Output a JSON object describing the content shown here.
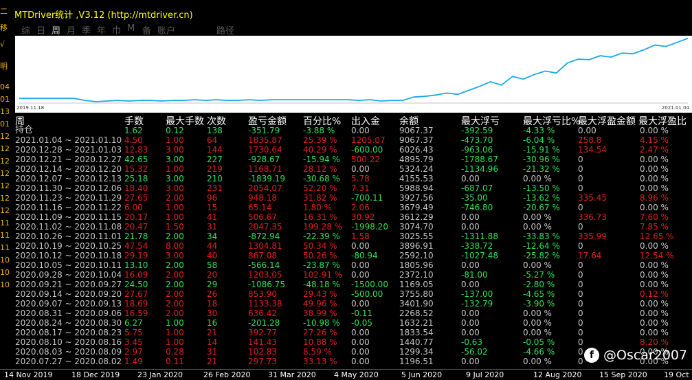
{
  "window": {
    "title": "MTDriver统计 ,V3.12 (http://mtdriver.cn)"
  },
  "left_strip": [
    "二",
    "移",
    "√",
    "明",
    "04",
    "01",
    "13",
    "01",
    "12",
    "12",
    "12",
    "12",
    "12",
    "12",
    "12",
    "11",
    "11",
    "11",
    "10",
    "10",
    "10"
  ],
  "toolbar": [
    "综",
    "日",
    "周",
    "月",
    "季",
    "年",
    "巾",
    "M",
    "备",
    "账户",
    "路径"
  ],
  "toolbar_active": "周",
  "chart": {
    "start_label": "2019.11.18",
    "end_label": "2021.01.04",
    "line_color": "#1aa7e6"
  },
  "chart_data": {
    "type": "line",
    "series": [
      {
        "values": [
          0,
          0,
          0,
          0,
          0,
          0,
          -0.3,
          -0.5,
          -0.4,
          -0.3,
          -0.4,
          -0.3,
          -0.3,
          -0.4,
          -0.3,
          -0.3,
          -0.2,
          -0.3,
          -0.2,
          -0.3,
          -0.3,
          -0.2,
          -0.3,
          -0.2,
          -0.2,
          -0.2,
          -0.2,
          -0.2,
          -0.2,
          -0.2,
          -0.2,
          -0.3,
          -0.2,
          -0.4,
          -0.3,
          -0.3,
          0.2,
          0.3,
          0.5,
          0.8,
          0.6,
          1.2,
          1.8,
          2.5,
          2.0,
          3.3,
          2.9,
          3.6,
          4.1,
          3.8,
          5.3,
          5.9,
          5.8,
          6.4,
          6.2,
          6.8,
          6.7,
          7.3,
          8.0,
          7.8,
          8.4,
          9.0
        ]
      }
    ]
  },
  "headers": [
    "周",
    "手数",
    "最大手数",
    "次数",
    "盈亏金额",
    "百分比%",
    "出入金",
    "余额",
    "最大浮亏",
    "最大浮亏比%",
    "最大浮盈金额",
    "最大浮盈比"
  ],
  "rows": [
    {
      "period": "持仓",
      "lots": "1.62",
      "max_lots": "0.12",
      "count": "138",
      "pnl": "-351.79",
      "pct": "-3.88 %",
      "io": "0.00",
      "bal": "9067.37",
      "mdd": "-392.59",
      "mddp": "-4.33 %",
      "mfe": "0.00",
      "mfep": "0.00 %",
      "col": "g"
    },
    {
      "period": "2021.01.04 ~ 2021.01.10",
      "lots": "4.50",
      "max_lots": "1.00",
      "count": "64",
      "pnl": "1835.87",
      "pct": "25.39 %",
      "io": "1205.07",
      "bal": "9067.37",
      "mdd": "-473.70",
      "mddp": "-6.04 %",
      "mfe": "258.8",
      "mfep": "4.15 %",
      "col": "r"
    },
    {
      "period": "2020.12.28 ~ 2021.01.03",
      "lots": "12.83",
      "max_lots": "3.00",
      "count": "144",
      "pnl": "1730.64",
      "pct": "40.29 %",
      "io": "-600.00",
      "bal": "6026.43",
      "mdd": "-963.06",
      "mddp": "-15.91 %",
      "mfe": "134.54",
      "mfep": "2.47 %",
      "col": "r"
    },
    {
      "period": "2020.12.21 ~ 2020.12.27",
      "lots": "42.65",
      "max_lots": "3.00",
      "count": "227",
      "pnl": "-928.67",
      "pct": "-15.94 %",
      "io": "500.22",
      "bal": "4895.79",
      "mdd": "-1788.67",
      "mddp": "-30.96 %",
      "mfe": "0",
      "mfep": "0.00 %",
      "col": "g"
    },
    {
      "period": "2020.12.14 ~ 2020.12.20",
      "lots": "15.32",
      "max_lots": "1.00",
      "count": "219",
      "pnl": "1168.71",
      "pct": "28.12 %",
      "io": "0.00",
      "bal": "5324.24",
      "mdd": "-1134.96",
      "mddp": "-21.32 %",
      "mfe": "0",
      "mfep": "0.00 %",
      "col": "r"
    },
    {
      "period": "2020.12.07 ~ 2020.12.13",
      "lots": "25.18",
      "max_lots": "3.00",
      "count": "210",
      "pnl": "-1839.19",
      "pct": "-30.68 %",
      "io": "5.78",
      "bal": "4155.53",
      "mdd": "0.00",
      "mddp": "0.00 %",
      "mfe": "0",
      "mfep": "0.00 %",
      "col": "g"
    },
    {
      "period": "2020.11.30 ~ 2020.12.06",
      "lots": "18.40",
      "max_lots": "3.00",
      "count": "231",
      "pnl": "2054.07",
      "pct": "52.20 %",
      "io": "7.31",
      "bal": "5988.94",
      "mdd": "-687.07",
      "mddp": "-13.50 %",
      "mfe": "0",
      "mfep": "0.00 %",
      "col": "r"
    },
    {
      "period": "2020.11.23 ~ 2020.11.29",
      "lots": "27.65",
      "max_lots": "2.00",
      "count": "96",
      "pnl": "948.18",
      "pct": "31.82 %",
      "io": "-700.11",
      "bal": "3927.56",
      "mdd": "-35.00",
      "mddp": "-13.62 %",
      "mfe": "335.45",
      "mfep": "8.96 %",
      "col": "r"
    },
    {
      "period": "2020.11.16 ~ 2020.11.22",
      "lots": "6.00",
      "max_lots": "1.00",
      "count": "15",
      "pnl": "65.14",
      "pct": "1.80 %",
      "io": "2.06",
      "bal": "3679.49",
      "mdd": "-746.80",
      "mddp": "-20.67 %",
      "mfe": "0",
      "mfep": "0.00 %",
      "col": "r"
    },
    {
      "period": "2020.11.09 ~ 2020.11.15",
      "lots": "20.17",
      "max_lots": "1.00",
      "count": "41",
      "pnl": "506.67",
      "pct": "16.31 %",
      "io": "30.92",
      "bal": "3612.29",
      "mdd": "0.00",
      "mddp": "0.00 %",
      "mfe": "336.73",
      "mfep": "7.60 %",
      "col": "r"
    },
    {
      "period": "2020.11.02 ~ 2020.11.08",
      "lots": "20.47",
      "max_lots": "1.50",
      "count": "31",
      "pnl": "2047.35",
      "pct": "199.28 %",
      "io": "-1998.20",
      "bal": "3074.70",
      "mdd": "0.00",
      "mddp": "0.00 %",
      "mfe": "0",
      "mfep": "7.85 %",
      "col": "r"
    },
    {
      "period": "2020.10.26 ~ 2020.11.01",
      "lots": "21.78",
      "max_lots": "2.00",
      "count": "34",
      "pnl": "-872.94",
      "pct": "-22.39 %",
      "io": "1.58",
      "bal": "3025.55",
      "mdd": "-1311.88",
      "mddp": "-33.83 %",
      "mfe": "335.99",
      "mfep": "12.65 %",
      "col": "g"
    },
    {
      "period": "2020.10.19 ~ 2020.10.25",
      "lots": "47.54",
      "max_lots": "8.00",
      "count": "44",
      "pnl": "1304.81",
      "pct": "50.34 %",
      "io": "0.00",
      "bal": "3896.91",
      "mdd": "-338.72",
      "mddp": "-12.64 %",
      "mfe": "0",
      "mfep": "0.00 %",
      "col": "r"
    },
    {
      "period": "2020.10.12 ~ 2020.10.18",
      "lots": "29.19",
      "max_lots": "3.00",
      "count": "40",
      "pnl": "867.08",
      "pct": "50.26 %",
      "io": "-80.94",
      "bal": "2592.10",
      "mdd": "-1027.48",
      "mddp": "-25.82 %",
      "mfe": "17.64",
      "mfep": "12.54 %",
      "col": "r"
    },
    {
      "period": "2020.10.05 ~ 2020.10.11",
      "lots": "13.10",
      "max_lots": "2.00",
      "count": "58",
      "pnl": "-566.14",
      "pct": "-23.87 %",
      "io": "0.00",
      "bal": "1805.96",
      "mdd": "0.00",
      "mddp": "0.00 %",
      "mfe": "0",
      "mfep": "0.00 %",
      "col": "g"
    },
    {
      "period": "2020.09.28 ~ 2020.10.04",
      "lots": "16.09",
      "max_lots": "2.00",
      "count": "20",
      "pnl": "1203.05",
      "pct": "102.91 %",
      "io": "0.00",
      "bal": "2372.10",
      "mdd": "-81.00",
      "mddp": "-5.27 %",
      "mfe": "0",
      "mfep": "0.00 %",
      "col": "r"
    },
    {
      "period": "2020.09.21 ~ 2020.09.27",
      "lots": "24.50",
      "max_lots": "2.00",
      "count": "29",
      "pnl": "-1086.75",
      "pct": "-48.18 %",
      "io": "-1500.00",
      "bal": "1169.05",
      "mdd": "0.00",
      "mddp": "-2.80 %",
      "mfe": "0",
      "mfep": "0.00 %",
      "col": "g"
    },
    {
      "period": "2020.09.14 ~ 2020.09.20",
      "lots": "27.67",
      "max_lots": "2.00",
      "count": "26",
      "pnl": "853.90",
      "pct": "29.43 %",
      "io": "-500.00",
      "bal": "3755.80",
      "mdd": "-137.00",
      "mddp": "-4.65 %",
      "mfe": "0",
      "mfep": "0.12 %",
      "col": "r"
    },
    {
      "period": "2020.09.07 ~ 2020.09.13",
      "lots": "18.69",
      "max_lots": "2.00",
      "count": "18",
      "pnl": "1133.38",
      "pct": "49.96 %",
      "io": "0.00",
      "bal": "3401.90",
      "mdd": "-132.79",
      "mddp": "-3.90 %",
      "mfe": "0",
      "mfep": "0.00 %",
      "col": "r"
    },
    {
      "period": "2020.08.31 ~ 2020.09.06",
      "lots": "16.59",
      "max_lots": "2.00",
      "count": "30",
      "pnl": "636.42",
      "pct": "38.99 %",
      "io": "-0.11",
      "bal": "2268.52",
      "mdd": "0.00",
      "mddp": "0.00 %",
      "mfe": "0",
      "mfep": "0.00 %",
      "col": "r"
    },
    {
      "period": "2020.08.24 ~ 2020.08.30",
      "lots": "6.27",
      "max_lots": "1.00",
      "count": "16",
      "pnl": "-201.28",
      "pct": "-10.98 %",
      "io": "-0.05",
      "bal": "1632.21",
      "mdd": "0.00",
      "mddp": "0.00 %",
      "mfe": "0",
      "mfep": "0.00 %",
      "col": "g"
    },
    {
      "period": "2020.08.17 ~ 2020.08.23",
      "lots": "5.75",
      "max_lots": "1.00",
      "count": "21",
      "pnl": "392.77",
      "pct": "27.26 %",
      "io": "0.00",
      "bal": "1833.54",
      "mdd": "0.00",
      "mddp": "0.00 %",
      "mfe": "0",
      "mfep": "0.00 %",
      "col": "r"
    },
    {
      "period": "2020.08.10 ~ 2020.08.16",
      "lots": "3.45",
      "max_lots": "1.00",
      "count": "14",
      "pnl": "141.43",
      "pct": "10.88 %",
      "io": "0.00",
      "bal": "1440.77",
      "mdd": "-0.63",
      "mddp": "-0.05 %",
      "mfe": "0",
      "mfep": "8.20 %",
      "col": "r"
    },
    {
      "period": "2020.08.03 ~ 2020.08.09",
      "lots": "2.97",
      "max_lots": "0.28",
      "count": "31",
      "pnl": "102.83",
      "pct": "8.59 %",
      "io": "0.00",
      "bal": "1299.34",
      "mdd": "-56.02",
      "mddp": "-4.66 %",
      "mfe": "0",
      "mfep": "0.00 %",
      "col": "r"
    },
    {
      "period": "2020.07.27 ~ 2020.08.02",
      "lots": "1.49",
      "max_lots": "0.11",
      "count": "21",
      "pnl": "297.73",
      "pct": "33.13 %",
      "io": "0.00",
      "bal": "1196.51",
      "mdd": "0.00",
      "mddp": "0.00 %",
      "mfe": "0",
      "mfep": "0.00 %",
      "col": "r"
    }
  ],
  "xaxis": [
    "14 Nov 2019",
    "18 Dec 2019",
    "23 Jan 2020",
    "26 Feb 2020",
    "31 Mar 2020",
    "4 May 2020",
    "5 Jun 2020",
    "9 Jul 2020",
    "12 Aug 2020",
    "15 Sep 2020",
    "19 Oct"
  ],
  "watermark": "@Oscar2007"
}
